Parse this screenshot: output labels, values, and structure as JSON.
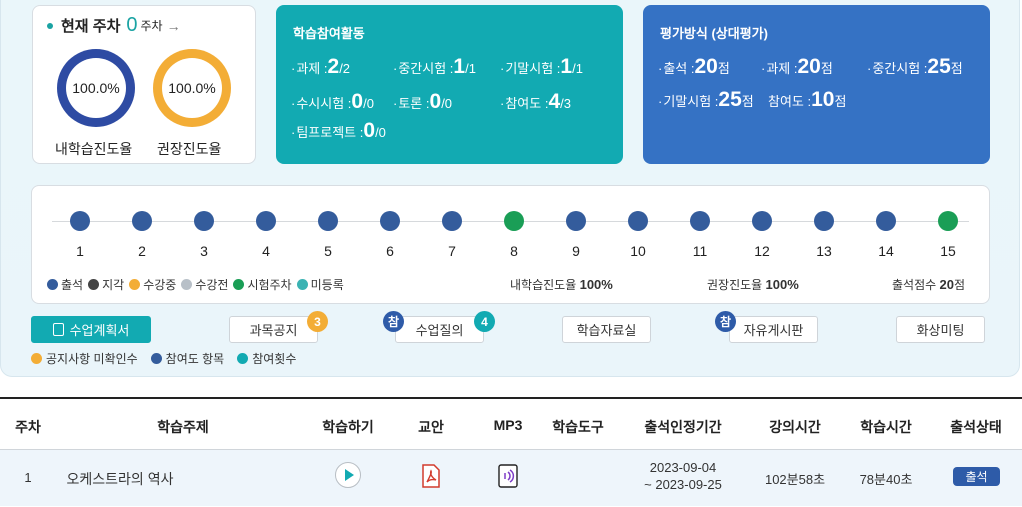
{
  "progress": {
    "title": "현재 주차",
    "week": "0",
    "unit": "주차",
    "arrow": "→",
    "rings": [
      {
        "label": "내학습진도율",
        "value": "100.0%",
        "color": "#2e4ba3"
      },
      {
        "label": "권장진도율",
        "value": "100.0%",
        "color": "#f3ad36"
      }
    ]
  },
  "activity": {
    "title": "학습참여활동",
    "items": [
      {
        "label": "과제 :",
        "value": "2",
        "total": "/2"
      },
      {
        "label": "중간시험 :",
        "value": "1",
        "total": "/1"
      },
      {
        "label": "기말시험 :",
        "value": "1",
        "total": "/1"
      },
      {
        "label": "수시시험 :",
        "value": "0",
        "total": "/0"
      },
      {
        "label": "토론 :",
        "value": "0",
        "total": "/0"
      },
      {
        "label": "참여도 :",
        "value": "4",
        "total": "/3"
      },
      {
        "label": "팀프로젝트 :",
        "value": "0",
        "total": "/0"
      }
    ]
  },
  "evaluation": {
    "title": "평가방식 (상대평가)",
    "items": [
      {
        "label": "출석 :",
        "value": "20",
        "unit": "점"
      },
      {
        "label": "과제 :",
        "value": "20",
        "unit": "점"
      },
      {
        "label": "중간시험 :",
        "value": "25",
        "unit": "점"
      },
      {
        "label": "기말시험 :",
        "value": "25",
        "unit": "점"
      },
      {
        "label": "참여도 :",
        "value": "10",
        "unit": "점"
      }
    ]
  },
  "timeline": {
    "weeks": [
      {
        "n": "1",
        "status": "출석"
      },
      {
        "n": "2",
        "status": "출석"
      },
      {
        "n": "3",
        "status": "출석"
      },
      {
        "n": "4",
        "status": "출석"
      },
      {
        "n": "5",
        "status": "출석"
      },
      {
        "n": "6",
        "status": "출석"
      },
      {
        "n": "7",
        "status": "출석"
      },
      {
        "n": "8",
        "status": "시험주차"
      },
      {
        "n": "9",
        "status": "출석"
      },
      {
        "n": "10",
        "status": "출석"
      },
      {
        "n": "11",
        "status": "출석"
      },
      {
        "n": "12",
        "status": "출석"
      },
      {
        "n": "13",
        "status": "출석"
      },
      {
        "n": "14",
        "status": "출석"
      },
      {
        "n": "15",
        "status": "시험주차"
      }
    ],
    "legend": [
      {
        "label": "출석",
        "color": "#345c9c"
      },
      {
        "label": "지각",
        "color": "#444444"
      },
      {
        "label": "수강중",
        "color": "#f3ad36"
      },
      {
        "label": "수강전",
        "color": "#b8c0c8"
      },
      {
        "label": "시험주차",
        "color": "#1a9e56"
      },
      {
        "label": "미등록",
        "color": "#3bb3b3"
      }
    ],
    "summary": [
      {
        "label": "내학습진도율",
        "value": "100",
        "unit": "%"
      },
      {
        "label": "권장진도율",
        "value": "100",
        "unit": "%"
      },
      {
        "label": "출석점수",
        "value": "20",
        "unit": "점"
      }
    ]
  },
  "buttons": {
    "plan": "수업계획서",
    "notice": "과목공지",
    "notice_badge": "3",
    "qna_tag": "참",
    "qna": "수업질의",
    "qna_badge": "4",
    "materials": "학습자료실",
    "board_tag": "참",
    "board": "자유게시판",
    "meeting": "화상미팅"
  },
  "footer_legend": [
    {
      "label": "공지사항 미확인수",
      "color": "#f3ad36"
    },
    {
      "label": "참여도 항목",
      "color": "#345c9c"
    },
    {
      "label": "참여횟수",
      "color": "#12aab2"
    }
  ],
  "table": {
    "headers": [
      "주차",
      "학습주제",
      "학습하기",
      "교안",
      "MP3",
      "학습도구",
      "출석인정기간",
      "강의시간",
      "학습시간",
      "출석상태"
    ],
    "rows": [
      {
        "week": "1",
        "topic": "오케스트라의 역사",
        "period_start": "2023-09-04",
        "period_end": "~ 2023-09-25",
        "lecture_time": "102분58초",
        "study_time": "78분40초",
        "status": "출석"
      }
    ]
  }
}
